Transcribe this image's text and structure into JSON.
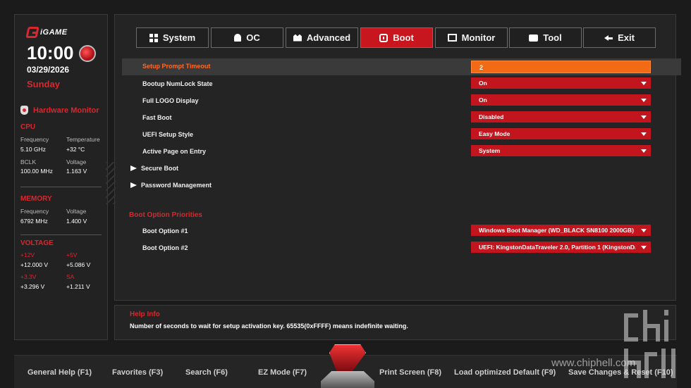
{
  "brand": {
    "name": "iGAME"
  },
  "status": {
    "time": "10:00",
    "date": "03/29/2026",
    "day": "Sunday"
  },
  "hardware_monitor": {
    "title": "Hardware Monitor",
    "cpu": {
      "title": "CPU",
      "frequency_label": "Frequency",
      "frequency_value": "5.10 GHz",
      "temperature_label": "Temperature",
      "temperature_value": "+32 °C",
      "bclk_label": "BCLK",
      "bclk_value": "100.00 MHz",
      "voltage_label": "Voltage",
      "voltage_value": "1.163 V"
    },
    "memory": {
      "title": "MEMORY",
      "frequency_label": "Frequency",
      "frequency_value": "6792 MHz",
      "voltage_label": "Voltage",
      "voltage_value": "1.400 V"
    },
    "voltage": {
      "title": "VOLTAGE",
      "v12_label": "+12V",
      "v12_value": "+12.000 V",
      "v5_label": "+5V",
      "v5_value": "+5.086 V",
      "v33_label": "+3.3V",
      "v33_value": "+3.296 V",
      "sa_label": "SA",
      "sa_value": "+1.211 V"
    }
  },
  "tabs": [
    {
      "label": "System",
      "icon": "grid-icon"
    },
    {
      "label": "OC",
      "icon": "rocket-icon"
    },
    {
      "label": "Advanced",
      "icon": "crown-icon"
    },
    {
      "label": "Boot",
      "icon": "power-icon",
      "active": true
    },
    {
      "label": "Monitor",
      "icon": "monitor-icon"
    },
    {
      "label": "Tool",
      "icon": "toolbox-icon"
    },
    {
      "label": "Exit",
      "icon": "exit-arrow-icon"
    }
  ],
  "settings": {
    "setup_prompt_timeout": {
      "label": "Setup Prompt Timeout",
      "value": "2"
    },
    "numlock": {
      "label": "Bootup NumLock State",
      "value": "On"
    },
    "full_logo": {
      "label": "Full LOGO Display",
      "value": "On"
    },
    "fast_boot": {
      "label": "Fast Boot",
      "value": "Disabled"
    },
    "uefi_style": {
      "label": "UEFI Setup Style",
      "value": "Easy Mode"
    },
    "active_page": {
      "label": "Active Page on Entry",
      "value": "System"
    },
    "secure_boot": {
      "label": "Secure Boot"
    },
    "password_mgmt": {
      "label": "Password Management"
    },
    "boot_priorities_title": "Boot Option Priorities",
    "boot_option_1": {
      "label": "Boot Option #1",
      "value": "Windows Boot Manager (WD_BLACK SN8100 2000GB)"
    },
    "boot_option_2": {
      "label": "Boot Option #2",
      "value": "UEFI: KingstonDataTraveler 2.0, Partition 1 (KingstonDataTraveler 2.0)"
    }
  },
  "help": {
    "title": "Help Info",
    "text": "Number of seconds to wait for setup activation key. 65535(0xFFFF) means indefinite waiting."
  },
  "function_keys": {
    "general_help": "General Help (F1)",
    "favorites": "Favorites (F3)",
    "search": "Search (F6)",
    "ez_mode": "EZ Mode (F7)",
    "print_screen": "Print Screen (F8)",
    "load_defaults": "Load optimized Default (F9)",
    "save_reset": "Save Changes & Reset (F10)"
  },
  "watermark": {
    "url": "www.chiphell.com"
  },
  "colors": {
    "accent_red": "#c8161e",
    "highlight_orange": "#f36a14",
    "background": "#1b1b1b"
  }
}
